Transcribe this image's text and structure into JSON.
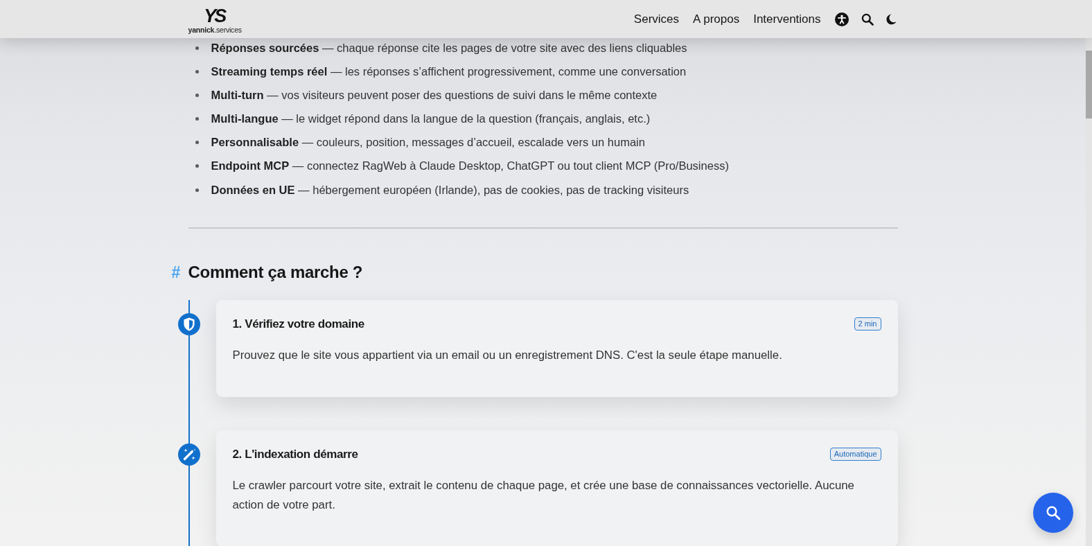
{
  "header": {
    "logo": {
      "mark": "YS",
      "name": "**yannick**.services"
    },
    "nav": [
      {
        "label": "Services"
      },
      {
        "label": "A propos"
      },
      {
        "label": "Interventions"
      }
    ]
  },
  "features": [
    "**Réponses sourcées** — chaque réponse cite les pages de votre site avec des liens cliquables",
    "**Streaming temps réel** — les réponses s’affichent progressivement, comme une conversation",
    "**Multi-turn** — vos visiteurs peuvent poser des questions de suivi dans le même contexte",
    "**Multi-langue** — le widget répond dans la langue de la question (français, anglais, etc.)",
    "**Personnalisable** — couleurs, position, messages d’accueil, escalade vers un humain",
    "**Endpoint MCP** — connectez RagWeb à Claude Desktop, ChatGPT ou tout client MCP (Pro/Business)",
    "**Données en UE** — hébergement européen (Irlande), pas de cookies, pas de tracking visiteurs"
  ],
  "section": {
    "marker": "#",
    "title": "Comment ça marche ?"
  },
  "steps": [
    {
      "title": "1. Vérifiez votre domaine",
      "badge": "2 min",
      "description": "Prouvez que le site vous appartient via un email ou un enregistrement DNS. C'est la seule étape manuelle."
    },
    {
      "title": "2. L'indexation démarre",
      "badge": "Automatique",
      "description": "Le crawler parcourt votre site, extrait le contenu de chaque page, et crée une base de connaissances vectorielle. Aucune action de votre part."
    }
  ]
}
